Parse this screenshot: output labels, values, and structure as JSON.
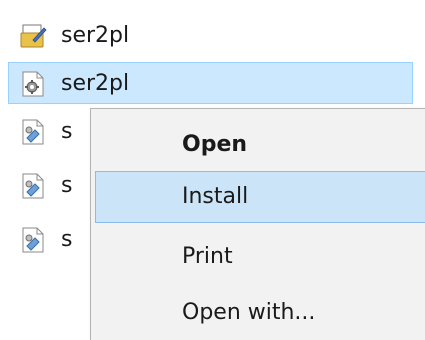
{
  "files": [
    {
      "name": "ser2pl",
      "icon": "batch-file-icon",
      "selected": false
    },
    {
      "name": "ser2pl",
      "icon": "settings-file-icon",
      "selected": true
    },
    {
      "name": "s",
      "icon": "config-file-icon",
      "selected": false
    },
    {
      "name": "s",
      "icon": "config-file-icon",
      "selected": false
    },
    {
      "name": "s",
      "icon": "config-file-icon",
      "selected": false
    }
  ],
  "context_menu": {
    "items": [
      {
        "label": "Open",
        "default": true
      },
      {
        "label": "Install",
        "highlighted": true
      },
      {
        "label": "Print"
      },
      {
        "label": "Open with..."
      }
    ]
  },
  "colors": {
    "selection_fill": "#cce8ff",
    "selection_border": "#99d1ff",
    "menu_background": "#f2f2f2",
    "menu_highlight": "#cce4f7"
  }
}
